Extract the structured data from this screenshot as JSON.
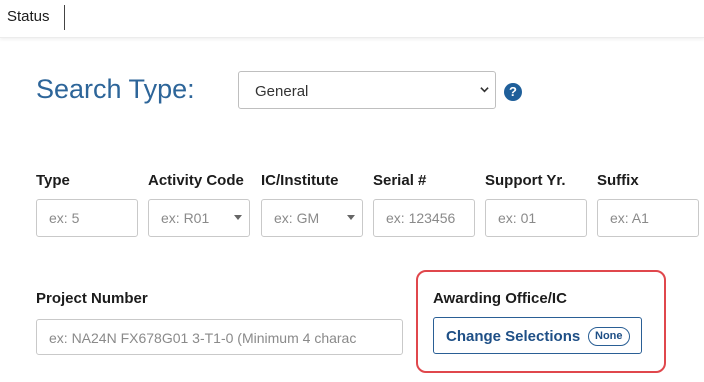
{
  "topbar": {
    "tab_label": "Status"
  },
  "search": {
    "label": "Search Type:",
    "selected": "General"
  },
  "fields": {
    "type": {
      "label": "Type",
      "placeholder": "ex: 5"
    },
    "activity_code": {
      "label": "Activity Code",
      "placeholder": "ex: R01"
    },
    "ic_institute": {
      "label": "IC/Institute",
      "placeholder": "ex: GM"
    },
    "serial": {
      "label": "Serial #",
      "placeholder": "ex: 123456"
    },
    "support_yr": {
      "label": "Support Yr.",
      "placeholder": "ex: 01"
    },
    "suffix": {
      "label": "Suffix",
      "placeholder": "ex: A1"
    }
  },
  "project": {
    "label": "Project Number",
    "placeholder": "ex: NA24N FX678G01 3-T1-0 (Minimum 4 charac"
  },
  "awarding": {
    "label": "Awarding Office/IC",
    "button_label": "Change Selections",
    "badge": "None"
  },
  "icons": {
    "help": "question-circle-icon",
    "dropdown": "chevron-down-icon",
    "caret": "caret-down-icon"
  },
  "colors": {
    "heading": "#2d6599",
    "accent": "#1e4f86",
    "highlight_border": "#e0474c"
  }
}
